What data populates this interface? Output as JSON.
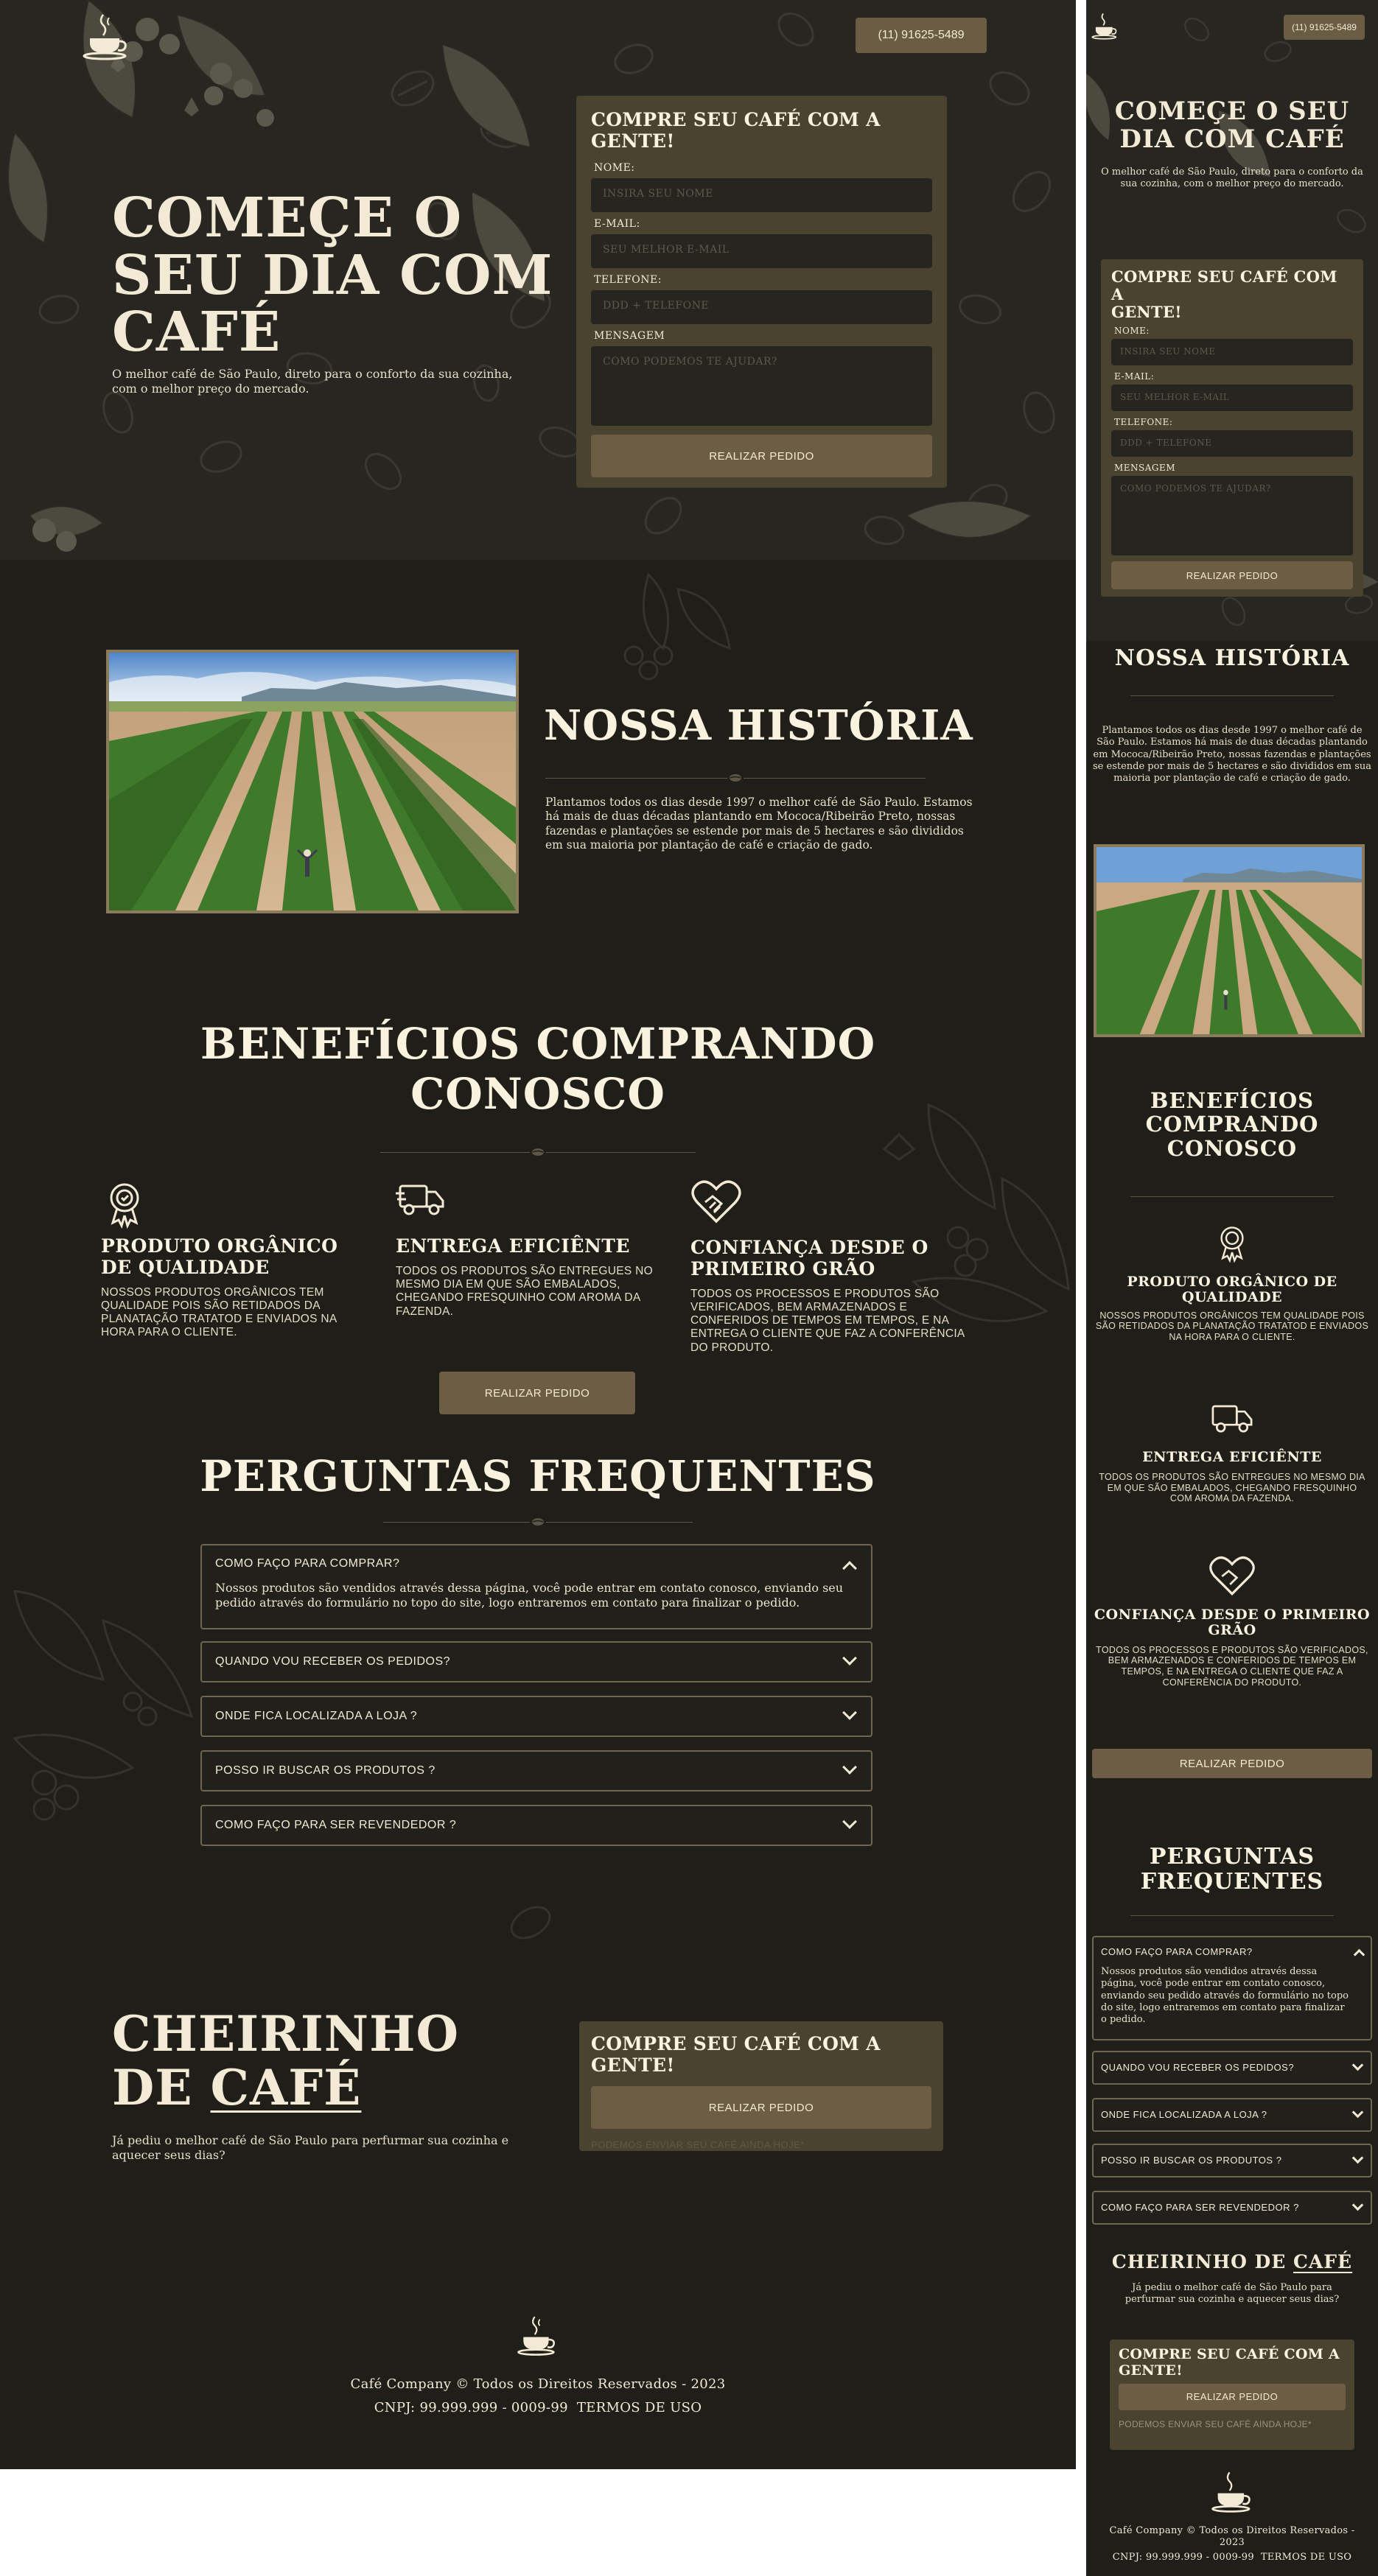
{
  "header": {
    "phone": "(11) 91625-5489"
  },
  "hero": {
    "title": "COMEÇE O SEU DIA COM CAFÉ",
    "title_lines": [
      "COMEÇE O",
      "SEU DIA COM",
      "CAFÉ"
    ],
    "subtitle": "O melhor café de São Paulo, direto para o conforto da sua cozinha, com o melhor preço do mercado."
  },
  "order_form": {
    "title": "COMPRE SEU CAFÉ COM A GENTE!",
    "name_label": "NOME:",
    "name_placeholder": "INSIRA SEU NOME",
    "email_label": "E-MAIL:",
    "email_placeholder": "SEU MELHOR E-MAIL",
    "phone_label": "TELEFONE:",
    "phone_placeholder": "DDD + TELEFONE",
    "message_label": "MENSAGEM",
    "message_placeholder": "COMO PODEMOS TE AJUDAR?",
    "submit_label": "REALIZAR PEDIDO"
  },
  "history": {
    "title": "NOSSA HISTÓRIA",
    "text": "Plantamos todos os dias desde 1997 o melhor café de São Paulo. Estamos há mais de duas décadas plantando em Mococa/Ribeirão Preto, nossas fazendas e plantações se estende por mais de 5 hectares e são divididos em sua maioria por plantação de café e criação de gado."
  },
  "benefits": {
    "title": "BENEFÍCIOS COMPRANDO CONOSCO",
    "title_lines": [
      "BENEFÍCIOS COMPRANDO",
      "CONOSCO"
    ],
    "items": [
      {
        "icon": "award-badge-icon",
        "title": "PRODUTO ORGÂNICO DE QUALIDADE",
        "text": "NOSSOS PRODUTOS ORGÂNICOS TEM QUALIDADE POIS SÃO RETIDADOS DA PLANATAÇÃO TRATATOD E ENVIADOS NA HORA PARA O CLIENTE."
      },
      {
        "icon": "delivery-truck-icon",
        "title": "ENTREGA EFICIÊNTE",
        "text": "TODOS OS PRODUTOS SÃO ENTREGUES NO MESMO DIA EM QUE SÃO EMBALADOS, CHEGANDO FRESQUINHO COM AROMA DA FAZENDA."
      },
      {
        "icon": "handshake-heart-icon",
        "title": "CONFIANÇA DESDE O PRIMEIRO GRÃO",
        "text": "TODOS OS PROCESSOS E PRODUTOS SÃO VERIFICADOS, BEM ARMAZENADOS E CONFERIDOS DE TEMPOS EM TEMPOS, E NA ENTREGA O CLIENTE QUE FAZ A CONFERÊNCIA DO PRODUTO."
      }
    ],
    "cta_label": "REALIZAR PEDIDO"
  },
  "faq": {
    "title": "PERGUNTAS FREQUENTES",
    "items": [
      {
        "question": "COMO FAÇO PARA COMPRAR?",
        "answer": "Nossos produtos são vendidos através dessa página, você pode entrar em contato conosco, enviando seu pedido através do formulário no topo do site, logo entraremos em contato para finalizar o pedido.",
        "expanded": true
      },
      {
        "question": "QUANDO VOU RECEBER OS PEDIDOS?",
        "expanded": false
      },
      {
        "question": "ONDE FICA LOCALIZADA A LOJA ?",
        "expanded": false
      },
      {
        "question": "POSSO IR BUSCAR OS PRODUTOS ?",
        "expanded": false
      },
      {
        "question": "COMO FAÇO PARA SER REVENDEDOR ?",
        "expanded": false
      }
    ]
  },
  "cta": {
    "title_word1": "CHEIRINHO",
    "title_word2": "DE",
    "title_word3": "CAFÉ",
    "text": "Já pediu o melhor café de São Paulo para perfurmar sua cozinha e aquecer seus dias?",
    "box_title": "COMPRE SEU CAFÉ COM A GENTE!",
    "box_button": "REALIZAR PEDIDO",
    "box_note": "PODEMOS ENVIAR SEU CAFÉ AINDA HOJE*"
  },
  "footer": {
    "copyright": "Café Company © Todos os Direitos Reservados - 2023",
    "cnpj": "CNPJ: 99.999.999 - 0009-99",
    "terms": "TERMOS DE USO"
  },
  "mobile_texts": {
    "hero_line1": "COMEÇE O SEU",
    "hero_line2": "DIA COM CAFÉ",
    "cta_title": "CHEIRINHO DE",
    "form_title_l1": "COMPRE SEU CAFÉ COM A",
    "form_title_l2": "GENTE!",
    "benefits_l1": "BENEFÍCIOS",
    "benefits_l2": "COMPRANDO",
    "benefits_l3": "CONOSCO",
    "faq_l1": "PERGUNTAS",
    "faq_l2": "FREQUENTES",
    "benefit1_l1": "PRODUTO ORGÂNICO DE",
    "benefit1_l2": "QUALIDADE",
    "benefit3_l1": "CONFIANÇA DESDE O PRIMEIRO",
    "benefit3_l2": "GRÃO",
    "footer_l1": "Café Company © Todos os Direitos Reservados -",
    "footer_l2": "2023"
  },
  "colors": {
    "background": "#1f1e18",
    "hero_background": "#272621",
    "accent": "#6d5d44",
    "form_box": "#49432f",
    "text": "#f3ead6"
  }
}
